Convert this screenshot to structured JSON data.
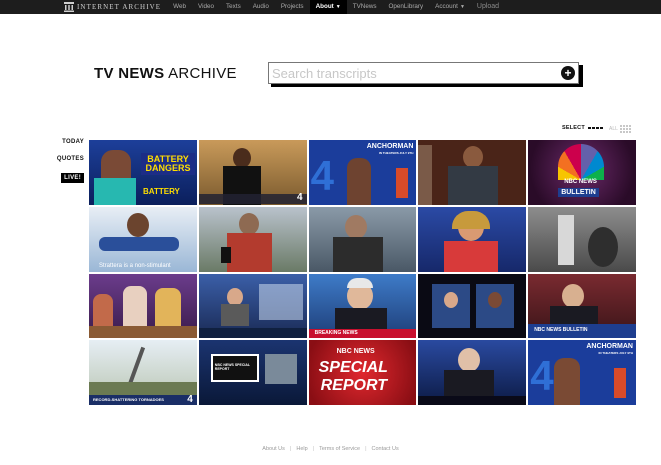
{
  "topnav": {
    "logo_text": "INTERNET ARCHIVE",
    "links": [
      "Web",
      "Video",
      "Texts",
      "Audio",
      "Projects"
    ],
    "active_link": "About",
    "links_after": [
      "TVNews",
      "OpenLibrary"
    ],
    "account_label": "Account",
    "upload_label": "Upload"
  },
  "header": {
    "title_bold": "TV NEWS",
    "title_rest": "ARCHIVE"
  },
  "search": {
    "placeholder": "Search transcripts",
    "button_icon": "plus-circle-icon"
  },
  "controls": {
    "select_label": "SELECT",
    "all_label": "ALL"
  },
  "sidebar": {
    "items": [
      "TODAY",
      "QUOTES",
      "LIVE!"
    ]
  },
  "thumbnails": [
    {
      "caption": "BATTERY DANGERS",
      "caption2": "BATTERY"
    },
    {
      "caption": "4"
    },
    {
      "caption": "ANCHORMAN",
      "caption2": "IN THEATERS JULY 9TH"
    },
    {
      "caption": ""
    },
    {
      "caption": "NBC NEWS",
      "caption2": "BULLETIN"
    },
    {
      "caption": "Strattera is a non-stimulant"
    },
    {
      "caption": ""
    },
    {
      "caption": ""
    },
    {
      "caption": ""
    },
    {
      "caption": ""
    },
    {
      "caption": ""
    },
    {
      "caption": ""
    },
    {
      "caption": "BREAKING NEWS"
    },
    {
      "caption": ""
    },
    {
      "caption": "NBC NEWS BULLETIN"
    },
    {
      "caption": "RECORD-SHATTERING TORNADOES",
      "caption2": "4"
    },
    {
      "caption": "NBC NEWS SPECIAL REPORT"
    },
    {
      "caption": "NBC NEWS",
      "caption2": "SPECIAL",
      "caption3": "REPORT"
    },
    {
      "caption": ""
    },
    {
      "caption": "ANCHORMAN",
      "caption2": "IN THEATERS JULY 9TH"
    }
  ],
  "footer": {
    "links": [
      "About Us",
      "Help",
      "Terms of Service",
      "Contact Us"
    ]
  },
  "colors": {
    "nav_bg": "#1d1d1d",
    "active_tab_bg": "#000000",
    "live_bg": "#000000"
  }
}
